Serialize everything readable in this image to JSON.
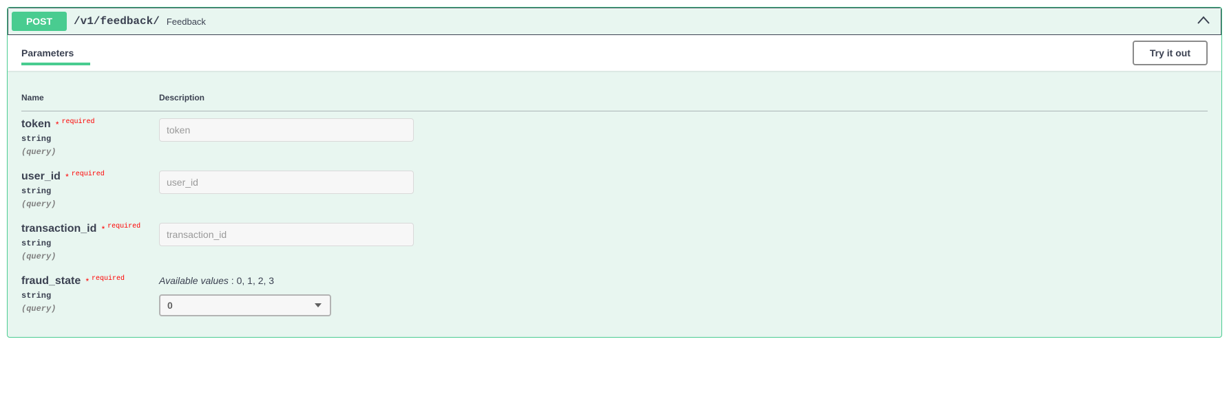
{
  "method": "POST",
  "path": "/v1/feedback/",
  "summary": "Feedback",
  "section_title": "Parameters",
  "try_out_label": "Try it out",
  "columns": {
    "name": "Name",
    "description": "Description"
  },
  "required_label": "required",
  "parameters": [
    {
      "name": "token",
      "type": "string",
      "in": "(query)",
      "required": true,
      "placeholder": "token"
    },
    {
      "name": "user_id",
      "type": "string",
      "in": "(query)",
      "required": true,
      "placeholder": "user_id"
    },
    {
      "name": "transaction_id",
      "type": "string",
      "in": "(query)",
      "required": true,
      "placeholder": "transaction_id"
    },
    {
      "name": "fraud_state",
      "type": "string",
      "in": "(query)",
      "required": true,
      "available_values_label": "Available values",
      "available_values": " : 0, 1, 2, 3",
      "select_value": "0"
    }
  ]
}
